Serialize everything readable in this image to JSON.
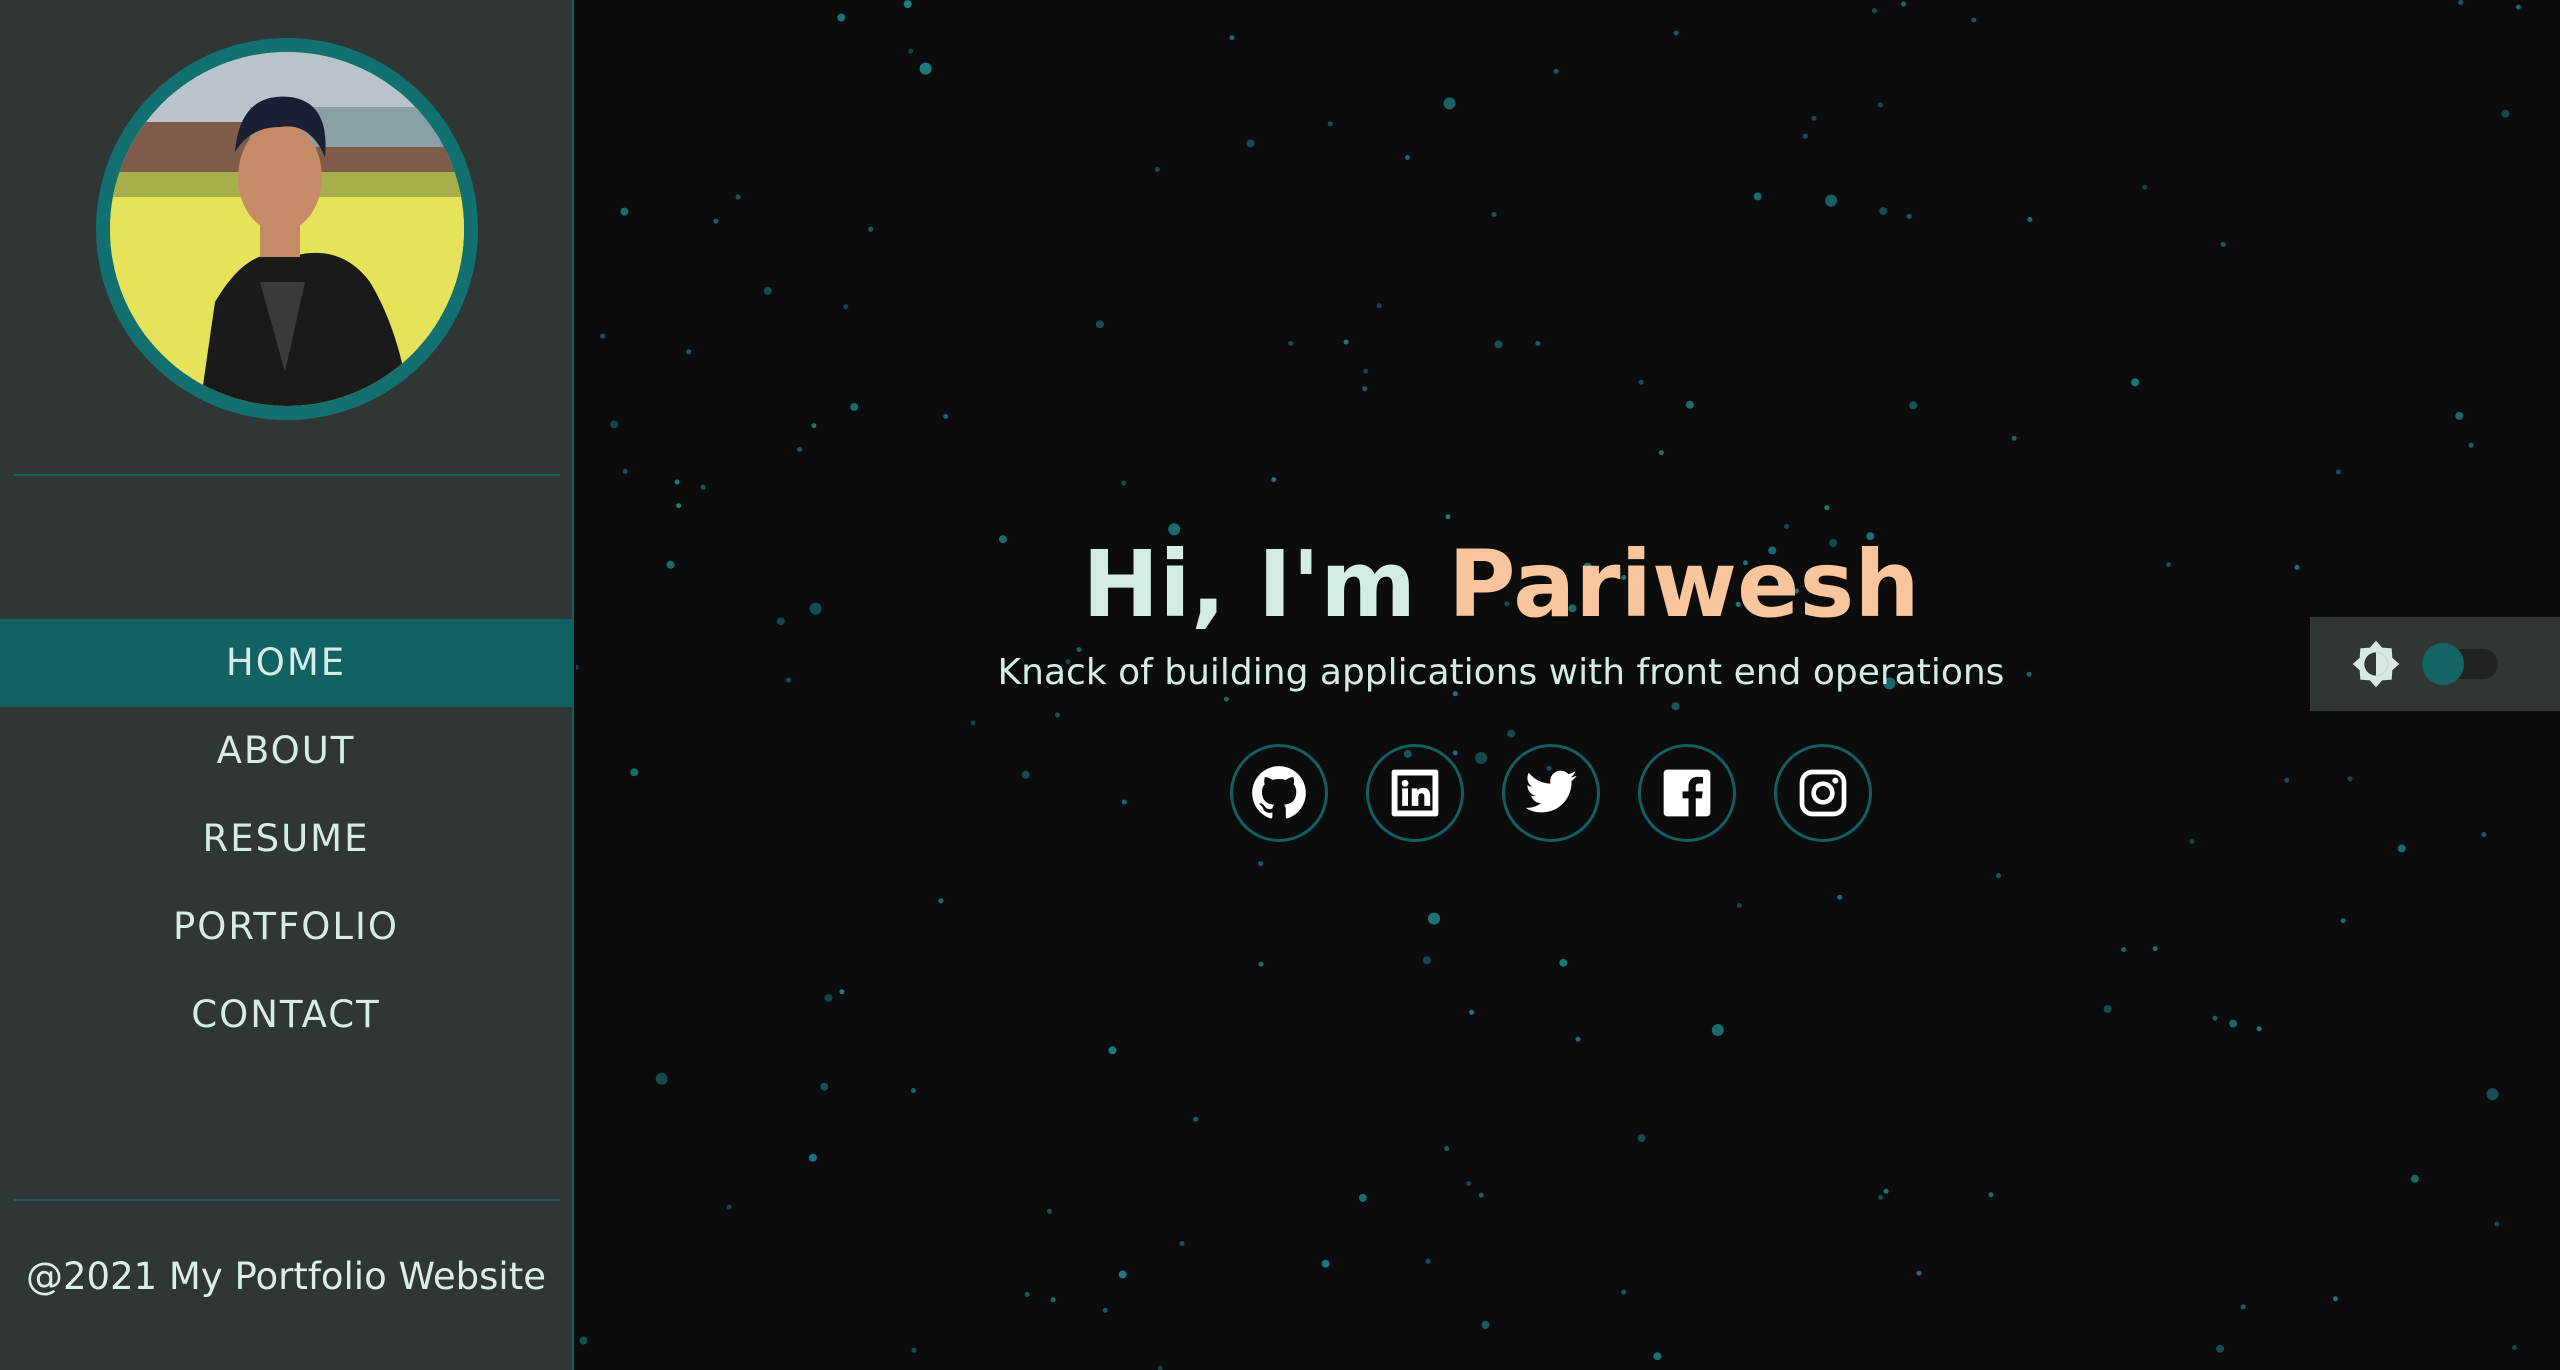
{
  "sidebar": {
    "avatar_alt": "Profile photo",
    "nav": [
      {
        "label": "HOME",
        "active": true
      },
      {
        "label": "ABOUT",
        "active": false
      },
      {
        "label": "RESUME",
        "active": false
      },
      {
        "label": "PORTFOLIO",
        "active": false
      },
      {
        "label": "CONTACT",
        "active": false
      }
    ],
    "footer": "@2021 My Portfolio Website"
  },
  "hero": {
    "greeting": "Hi, I'm ",
    "name": "Pariwesh",
    "subtitle": "Knack of building applications with front end operations"
  },
  "socials": [
    {
      "icon": "github-icon"
    },
    {
      "icon": "linkedin-icon"
    },
    {
      "icon": "twitter-icon"
    },
    {
      "icon": "facebook-icon"
    },
    {
      "icon": "instagram-icon"
    }
  ],
  "theme_toggle": {
    "icon": "brightness-icon",
    "state": "dark"
  },
  "colors": {
    "background": "#0c0c0c",
    "sidebar": "#2f3634",
    "accent": "#126263",
    "name_highlight": "#f9c59c",
    "text": "#d3ede6"
  }
}
